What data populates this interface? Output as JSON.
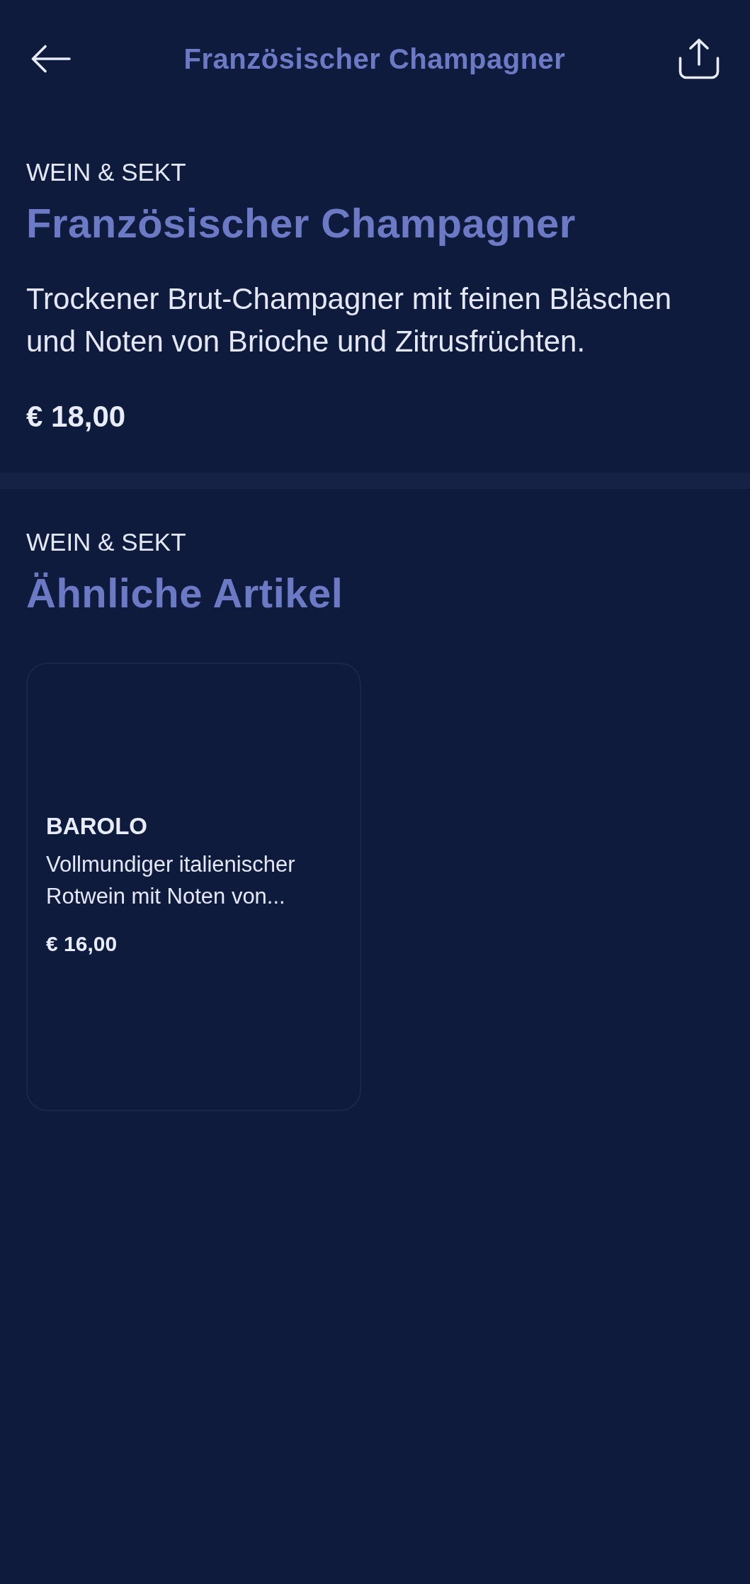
{
  "header": {
    "title": "Französischer Champagner"
  },
  "product": {
    "category": "WEIN & SEKT",
    "name": "Französischer Champagner",
    "description": "Trockener Brut-Champagner mit feinen Bläschen und Noten von Brioche und Zitrusfrüchten.",
    "price": "€ 18,00"
  },
  "similar": {
    "category": "WEIN & SEKT",
    "title": "Ähnliche Artikel",
    "items": [
      {
        "name": "BAROLO",
        "description": "Vollmundiger italienischer Rotwein mit Noten von...",
        "price": "€ 16,00"
      }
    ]
  }
}
